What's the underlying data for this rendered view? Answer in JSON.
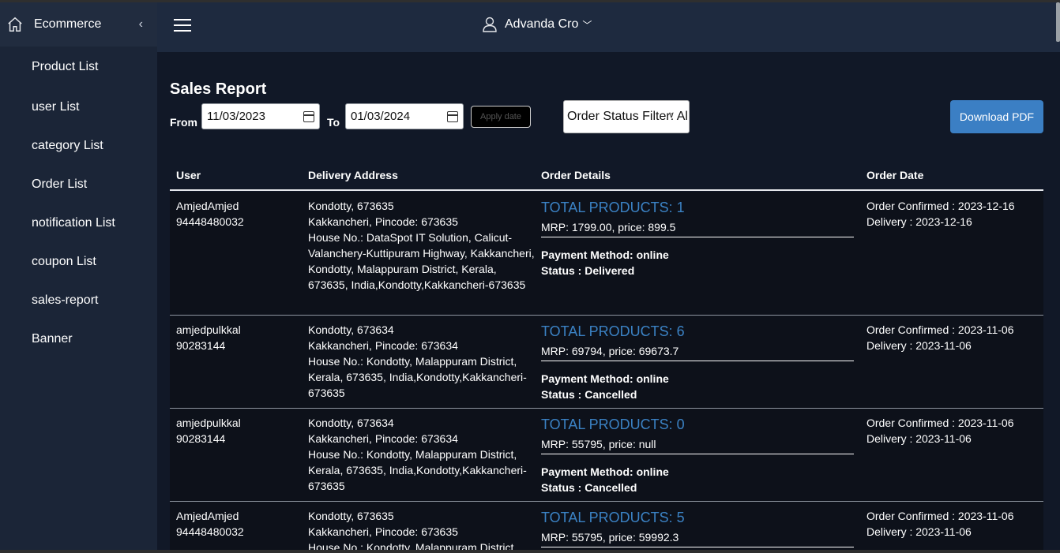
{
  "sidebar": {
    "brand": "Ecommerce",
    "items": [
      "Product List",
      "user List",
      "category List",
      "Order List",
      "notification List",
      "coupon List",
      "sales-report",
      "Banner"
    ]
  },
  "header": {
    "user_name": "Advanda Cro"
  },
  "page": {
    "title": "Sales Report"
  },
  "filters": {
    "from_label": "From",
    "from_value": "11/03/2023",
    "to_label": "To",
    "to_value": "01/03/2024",
    "apply_label": "Apply date",
    "status_filter": "Order Status Filter: All",
    "download_label": "Download PDF"
  },
  "table": {
    "headers": [
      "User",
      "Delivery Address",
      "Order Details",
      "Order Date"
    ],
    "rows": [
      {
        "user_name": "AmjedAmjed",
        "phone": "94448480032",
        "addr1": "Kondotty, 673635",
        "addr2": "Kakkancheri, Pincode: 673635",
        "addr3": "House No.: DataSpot IT Solution, Calicut-Valanchery-Kuttipuram Highway, Kakkancheri, Kondotty, Malappuram District, Kerala, 673635, India,Kondotty,Kakkancheri-673635",
        "total_products": "TOTAL PRODUCTS: 1",
        "mrp": "MRP: 1799.00, price: 899.5",
        "payment": "Payment Method: online",
        "status": "Status : Delivered",
        "confirmed": "Order Confirmed : 2023-12-16",
        "delivery": "Delivery : 2023-12-16"
      },
      {
        "user_name": "amjedpulkkal",
        "phone": "90283144",
        "addr1": "Kondotty, 673634",
        "addr2": "Kakkancheri, Pincode: 673634",
        "addr3": "House No.: Kondotty, Malappuram District, Kerala, 673635, India,Kondotty,Kakkancheri-673635",
        "total_products": "TOTAL PRODUCTS: 6",
        "mrp": "MRP: 69794, price: 69673.7",
        "payment": "Payment Method: online",
        "status": "Status : Cancelled",
        "confirmed": "Order Confirmed : 2023-11-06",
        "delivery": "Delivery : 2023-11-06"
      },
      {
        "user_name": "amjedpulkkal",
        "phone": "90283144",
        "addr1": "Kondotty, 673634",
        "addr2": "Kakkancheri, Pincode: 673634",
        "addr3": "House No.: Kondotty, Malappuram District, Kerala, 673635, India,Kondotty,Kakkancheri-673635",
        "total_products": "TOTAL PRODUCTS: 0",
        "mrp": "MRP: 55795, price: null",
        "payment": "Payment Method: online",
        "status": "Status : Cancelled",
        "confirmed": "Order Confirmed : 2023-11-06",
        "delivery": "Delivery : 2023-11-06"
      },
      {
        "user_name": "AmjedAmjed",
        "phone": "94448480032",
        "addr1": "Kondotty, 673635",
        "addr2": "Kakkancheri, Pincode: 673635",
        "addr3": "House No.: Kondotty, Malappuram District",
        "total_products": "TOTAL PRODUCTS: 5",
        "mrp": "MRP: 55795, price: 59992.3",
        "payment": "",
        "status": "",
        "confirmed": "Order Confirmed : 2023-11-06",
        "delivery": "Delivery : 2023-11-06"
      }
    ]
  },
  "colors": {
    "accent": "#3b82c4",
    "sidebar_bg": "#1b2537",
    "header_bg": "#1e2a3f",
    "page_bg": "#111827"
  }
}
